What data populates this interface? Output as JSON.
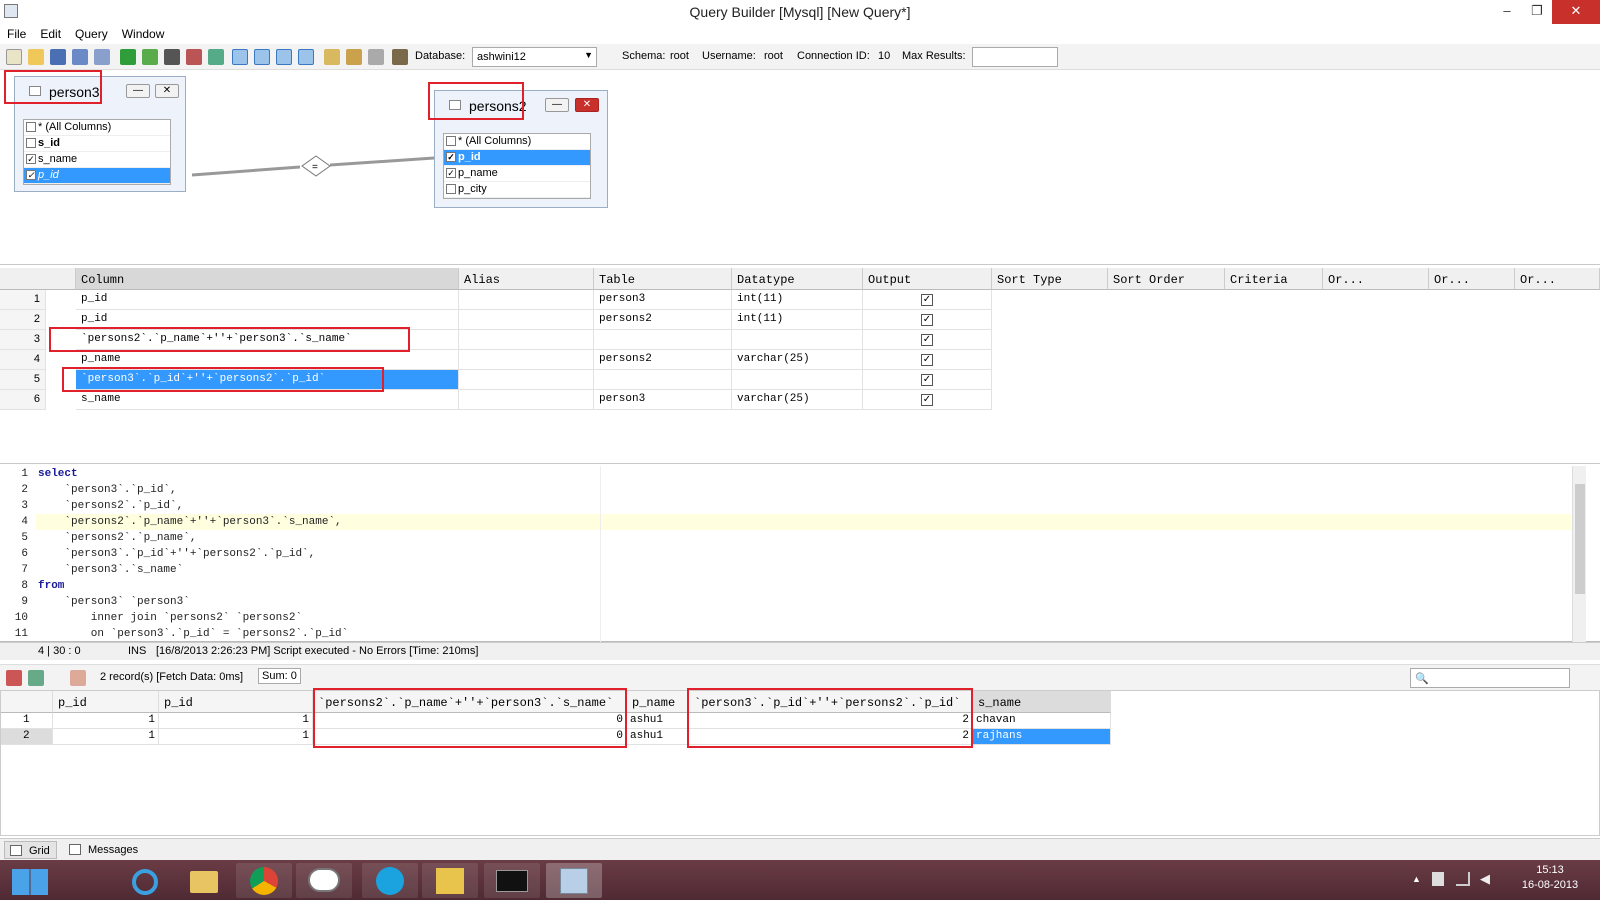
{
  "window": {
    "title": "Query Builder [Mysql] [New Query*]",
    "minimize": "–",
    "restore": "❐",
    "close": "✕"
  },
  "menu": [
    "File",
    "Edit",
    "Query",
    "Window"
  ],
  "toolbar": {
    "database_label": "Database:",
    "database_value": "ashwini12",
    "schema_label": "Schema:",
    "schema_value": "root",
    "username_label": "Username:",
    "username_value": "root",
    "connection_label": "Connection ID:",
    "connection_value": "10",
    "max_results_label": "Max Results:",
    "max_results_value": ""
  },
  "designer": {
    "table1": {
      "name": "person3",
      "columns": [
        {
          "label": "* (All Columns)",
          "checked": false
        },
        {
          "label": "s_id",
          "checked": false
        },
        {
          "label": "s_name",
          "checked": true
        },
        {
          "label": "p_id",
          "checked": true
        }
      ]
    },
    "table2": {
      "name": "persons2",
      "columns": [
        {
          "label": "* (All Columns)",
          "checked": false
        },
        {
          "label": "p_id",
          "checked": true
        },
        {
          "label": "p_name",
          "checked": true
        },
        {
          "label": "p_city",
          "checked": false
        }
      ]
    },
    "join_symbol": "="
  },
  "grid": {
    "headers": [
      "Column",
      "Alias",
      "Table",
      "Datatype",
      "Output",
      "Sort Type",
      "Sort Order",
      "Criteria",
      "Or...",
      "Or...",
      "Or..."
    ],
    "rows": [
      {
        "n": "1",
        "column": "p_id",
        "table": "person3",
        "datatype": "int(11)",
        "output": "✓"
      },
      {
        "n": "2",
        "column": "p_id",
        "table": "persons2",
        "datatype": "int(11)",
        "output": "✓"
      },
      {
        "n": "3",
        "column": "`persons2`.`p_name`+''+`person3`.`s_name`",
        "table": "",
        "datatype": "",
        "output": "✓"
      },
      {
        "n": "4",
        "column": "p_name",
        "table": "persons2",
        "datatype": "varchar(25)",
        "output": "✓"
      },
      {
        "n": "5",
        "column": "`person3`.`p_id`+''+`persons2`.`p_id`",
        "table": "",
        "datatype": "",
        "output": "✓"
      },
      {
        "n": "6",
        "column": "s_name",
        "table": "person3",
        "datatype": "varchar(25)",
        "output": "✓"
      }
    ]
  },
  "sql": [
    {
      "n": "1",
      "text": "select"
    },
    {
      "n": "2",
      "text": "    `person3`.`p_id`,"
    },
    {
      "n": "3",
      "text": "    `persons2`.`p_id`,"
    },
    {
      "n": "4",
      "text": "    `persons2`.`p_name`+''+`person3`.`s_name`,"
    },
    {
      "n": "5",
      "text": "    `persons2`.`p_name`,"
    },
    {
      "n": "6",
      "text": "    `person3`.`p_id`+''+`persons2`.`p_id`,"
    },
    {
      "n": "7",
      "text": "    `person3`.`s_name`"
    },
    {
      "n": "8",
      "text": "from"
    },
    {
      "n": "9",
      "text": "    `person3` `person3`"
    },
    {
      "n": "10",
      "text": "        inner join `persons2` `persons2`"
    },
    {
      "n": "11",
      "text": "        on `person3`.`p_id` = `persons2`.`p_id`"
    }
  ],
  "status": {
    "position": "4 | 30 : 0",
    "mode": "INS",
    "message": "[16/8/2013 2:26:23 PM] Script executed - No Errors [Time: 210ms]"
  },
  "results_toolbar": {
    "records": "2 record(s) [Fetch Data: 0ms]",
    "sum": "Sum: 0"
  },
  "results": {
    "headers": [
      "p_id",
      "p_id",
      "`persons2`.`p_name`+''+`person3`.`s_name`",
      "p_name",
      "`person3`.`p_id`+''+`persons2`.`p_id`",
      "s_name"
    ],
    "rows": [
      {
        "n": "1",
        "c1": "1",
        "c2": "1",
        "c3": "0",
        "c4": "ashu1",
        "c5": "2",
        "c6": "chavan"
      },
      {
        "n": "2",
        "c1": "1",
        "c2": "1",
        "c3": "0",
        "c4": "ashu1",
        "c5": "2",
        "c6": "rajhans"
      }
    ]
  },
  "bottom_tabs": [
    "Grid",
    "Messages"
  ],
  "taskbar": {
    "time": "15:13",
    "date": "16-08-2013"
  },
  "colors": {
    "selection": "#3399ff",
    "highlight_border": "#e0202a",
    "taskbar": "#5a313a"
  }
}
